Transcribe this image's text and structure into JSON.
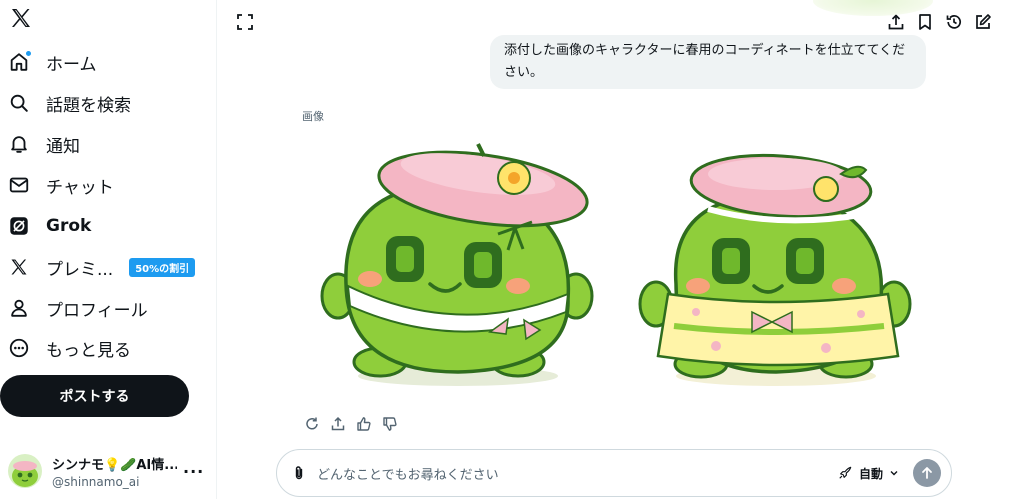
{
  "sidebar": {
    "items": [
      {
        "label": "ホーム",
        "icon": "home-icon"
      },
      {
        "label": "話題を検索",
        "icon": "search-icon"
      },
      {
        "label": "通知",
        "icon": "bell-icon"
      },
      {
        "label": "チャット",
        "icon": "mail-icon"
      },
      {
        "label": "Grok",
        "icon": "grok-icon"
      },
      {
        "label": "プレミ...",
        "icon": "x-premium-icon",
        "badge": "50%の割引"
      },
      {
        "label": "プロフィール",
        "icon": "person-icon"
      },
      {
        "label": "もっと見る",
        "icon": "more-circle-icon"
      }
    ],
    "post_label": "ポストする",
    "account": {
      "name": "シンナモ💡🥒AI情...",
      "handle": "@shinnamo_ai"
    }
  },
  "chat": {
    "user_message": "添付した画像のキャラクターに春用のコーディネートを仕立ててください。",
    "image_caption": "画像"
  },
  "composer": {
    "placeholder": "どんなことでもお尋ねください",
    "mode_label": "自動"
  },
  "colors": {
    "accent": "#1d9bf0",
    "text": "#0f1419",
    "muted": "#536471",
    "bubble": "#eff3f4",
    "character_green": "#8fce3b",
    "beret_pink": "#f4b6c4"
  }
}
